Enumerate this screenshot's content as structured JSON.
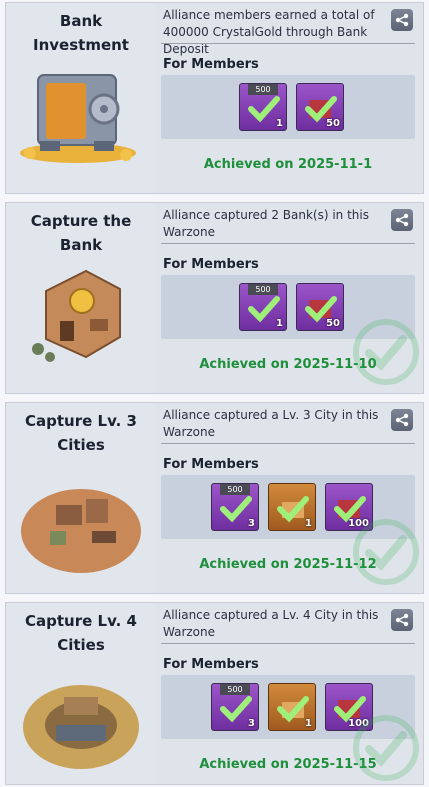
{
  "achievements": [
    {
      "title": "Bank\nInvestment",
      "description": "Alliance members earned a total of 400000 CrystalGold through Bank Deposit",
      "for_label": "For Members",
      "rewards": [
        {
          "type": "purple",
          "badge": "500",
          "count": "1"
        },
        {
          "type": "purple",
          "badge": "",
          "count": "50"
        }
      ],
      "achieved": "Achieved on 2025-11-1"
    },
    {
      "title": "Capture the\nBank",
      "description": "Alliance captured 2 Bank(s) in this Warzone",
      "for_label": "For Members",
      "rewards": [
        {
          "type": "purple",
          "badge": "500",
          "count": "1"
        },
        {
          "type": "purple",
          "badge": "",
          "count": "50"
        }
      ],
      "achieved": "Achieved on 2025-11-10"
    },
    {
      "title": "Capture Lv. 3\nCities",
      "description": "Alliance captured a Lv. 3 City in this Warzone",
      "for_label": "For Members",
      "rewards": [
        {
          "type": "purple",
          "badge": "500",
          "count": "3"
        },
        {
          "type": "orange",
          "badge": "",
          "count": "1"
        },
        {
          "type": "purple",
          "badge": "",
          "count": "100"
        }
      ],
      "achieved": "Achieved on 2025-11-12"
    },
    {
      "title": "Capture Lv. 4\nCities",
      "description": "Alliance captured a Lv. 4 City in this Warzone",
      "for_label": "For Members",
      "rewards": [
        {
          "type": "purple",
          "badge": "500",
          "count": "3"
        },
        {
          "type": "orange",
          "badge": "",
          "count": "1"
        },
        {
          "type": "purple",
          "badge": "",
          "count": "100"
        }
      ],
      "achieved": "Achieved on 2025-11-15"
    }
  ],
  "colors": {
    "achieved_text": "#1e8f3b",
    "reward_purple": "#8a45b8",
    "reward_orange": "#c07a30",
    "card_bg": "#dfe3ea"
  },
  "icons": {
    "share": "share-icon",
    "check": "checkmark-icon"
  }
}
